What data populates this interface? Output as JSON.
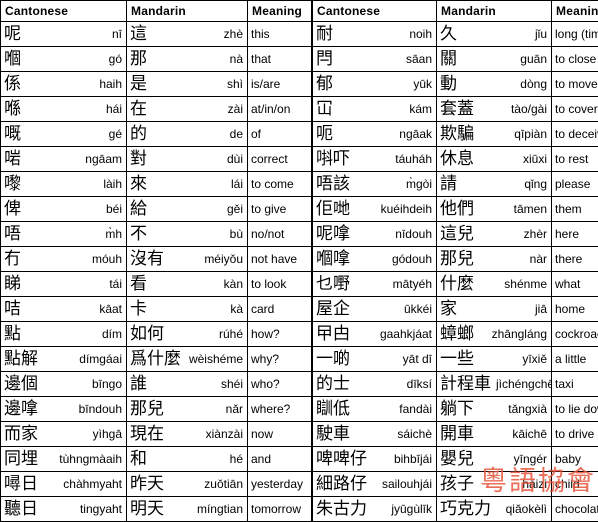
{
  "page": {
    "watermark": "粵語協會"
  },
  "columns": {
    "cantonese": "Cantonese",
    "mandarin": "Mandarin",
    "meaning": "Meaning"
  },
  "tables": [
    {
      "id": "left",
      "rows": [
        {
          "cant_hanzi": "呢",
          "cant_roman": "nī",
          "mand_hanzi": "這",
          "mand_roman": "zhè",
          "meaning": "this"
        },
        {
          "cant_hanzi": "嗰",
          "cant_roman": "gó",
          "mand_hanzi": "那",
          "mand_roman": "nà",
          "meaning": "that"
        },
        {
          "cant_hanzi": "係",
          "cant_roman": "haih",
          "mand_hanzi": "是",
          "mand_roman": "shì",
          "meaning": "is/are"
        },
        {
          "cant_hanzi": "喺",
          "cant_roman": "hái",
          "mand_hanzi": "在",
          "mand_roman": "zài",
          "meaning": "at/in/on"
        },
        {
          "cant_hanzi": "嘅",
          "cant_roman": "gé",
          "mand_hanzi": "的",
          "mand_roman": "de",
          "meaning": "of"
        },
        {
          "cant_hanzi": "啱",
          "cant_roman": "ngāam",
          "mand_hanzi": "對",
          "mand_roman": "dùi",
          "meaning": "correct"
        },
        {
          "cant_hanzi": "嚟",
          "cant_roman": "làih",
          "mand_hanzi": "來",
          "mand_roman": "lái",
          "meaning": "to come"
        },
        {
          "cant_hanzi": "俾",
          "cant_roman": "béi",
          "mand_hanzi": "給",
          "mand_roman": "gěi",
          "meaning": "to give"
        },
        {
          "cant_hanzi": "唔",
          "cant_roman": "m̀h",
          "mand_hanzi": "不",
          "mand_roman": "bù",
          "meaning": "no/not"
        },
        {
          "cant_hanzi": "冇",
          "cant_roman": "móuh",
          "mand_hanzi": "沒有",
          "mand_roman": "méiyǒu",
          "meaning": "not have"
        },
        {
          "cant_hanzi": "睇",
          "cant_roman": "tái",
          "mand_hanzi": "看",
          "mand_roman": "kàn",
          "meaning": "to look"
        },
        {
          "cant_hanzi": "咭",
          "cant_roman": "kāat",
          "mand_hanzi": "卡",
          "mand_roman": "kà",
          "meaning": "card"
        },
        {
          "cant_hanzi": "點",
          "cant_roman": "dím",
          "mand_hanzi": "如何",
          "mand_roman": "rúhé",
          "meaning": "how?"
        },
        {
          "cant_hanzi": "點解",
          "cant_roman": "dímgáai",
          "mand_hanzi": "爲什麼",
          "mand_roman": "wèishéme",
          "meaning": "why?"
        },
        {
          "cant_hanzi": "邊個",
          "cant_roman": "bīngo",
          "mand_hanzi": "誰",
          "mand_roman": "shéi",
          "meaning": "who?"
        },
        {
          "cant_hanzi": "邊嗱",
          "cant_roman": "bīndouh",
          "mand_hanzi": "那兒",
          "mand_roman": "nǎr",
          "meaning": "where?"
        },
        {
          "cant_hanzi": "而家",
          "cant_roman": "yìhgā",
          "mand_hanzi": "現在",
          "mand_roman": "xiànzài",
          "meaning": "now"
        },
        {
          "cant_hanzi": "同埋",
          "cant_roman": "tùhngmàaih",
          "mand_hanzi": "和",
          "mand_roman": "hé",
          "meaning": "and"
        },
        {
          "cant_hanzi": "噚日",
          "cant_roman": "chàhmyaht",
          "mand_hanzi": "昨天",
          "mand_roman": "zuǒtiān",
          "meaning": "yesterday"
        },
        {
          "cant_hanzi": "聽日",
          "cant_roman": "tingyaht",
          "mand_hanzi": "明天",
          "mand_roman": "míngtian",
          "meaning": "tomorrow"
        }
      ]
    },
    {
      "id": "right",
      "rows": [
        {
          "cant_hanzi": "耐",
          "cant_roman": "noih",
          "mand_hanzi": "久",
          "mand_roman": "jǐu",
          "meaning": "long (time)"
        },
        {
          "cant_hanzi": "閂",
          "cant_roman": "sāan",
          "mand_hanzi": "關",
          "mand_roman": "guān",
          "meaning": "to close"
        },
        {
          "cant_hanzi": "郁",
          "cant_roman": "yūk",
          "mand_hanzi": "動",
          "mand_roman": "dòng",
          "meaning": "to move"
        },
        {
          "cant_hanzi": "冚",
          "cant_roman": "kám",
          "mand_hanzi": "套蓋",
          "mand_roman": "tào/gài",
          "meaning": "to cover"
        },
        {
          "cant_hanzi": "呃",
          "cant_roman": "ngāak",
          "mand_hanzi": "欺騙",
          "mand_roman": "qīpiàn",
          "meaning": "to deceive"
        },
        {
          "cant_hanzi": "唞吓",
          "cant_roman": "táuháh",
          "mand_hanzi": "休息",
          "mand_roman": "xiūxi",
          "meaning": "to rest"
        },
        {
          "cant_hanzi": "唔該",
          "cant_roman": "m̀gòi",
          "mand_hanzi": "請",
          "mand_roman": "qǐng",
          "meaning": "please"
        },
        {
          "cant_hanzi": "佢哋",
          "cant_roman": "kuéihdeih",
          "mand_hanzi": "他們",
          "mand_roman": "tāmen",
          "meaning": "them"
        },
        {
          "cant_hanzi": "呢嗱",
          "cant_roman": "nīdouh",
          "mand_hanzi": "這兒",
          "mand_roman": "zhèr",
          "meaning": "here"
        },
        {
          "cant_hanzi": "嗰嗱",
          "cant_roman": "gódouh",
          "mand_hanzi": "那兒",
          "mand_roman": "nàr",
          "meaning": "there"
        },
        {
          "cant_hanzi": "乜嘢",
          "cant_roman": "mātyéh",
          "mand_hanzi": "什麼",
          "mand_roman": "shénme",
          "meaning": "what"
        },
        {
          "cant_hanzi": "屋企",
          "cant_roman": "ūkkéi",
          "mand_hanzi": "家",
          "mand_roman": "jiā",
          "meaning": "home"
        },
        {
          "cant_hanzi": "曱甴",
          "cant_roman": "gaahkjáat",
          "mand_hanzi": "蟑螂",
          "mand_roman": "zhāngláng",
          "meaning": "cockroach"
        },
        {
          "cant_hanzi": "一啲",
          "cant_roman": "yāt dī",
          "mand_hanzi": "一些",
          "mand_roman": "yīxiě",
          "meaning": "a little"
        },
        {
          "cant_hanzi": "的士",
          "cant_roman": "dīksí",
          "mand_hanzi": "計程車",
          "mand_roman": "jìchéngchē",
          "meaning": "taxi"
        },
        {
          "cant_hanzi": "瞓低",
          "cant_roman": "fandài",
          "mand_hanzi": "躺下",
          "mand_roman": "tǎngxià",
          "meaning": "to lie down"
        },
        {
          "cant_hanzi": "駛車",
          "cant_roman": "sáichè",
          "mand_hanzi": "開車",
          "mand_roman": "kāichē",
          "meaning": "to drive"
        },
        {
          "cant_hanzi": "啤啤仔",
          "cant_roman": "bihbījái",
          "mand_hanzi": "嬰兒",
          "mand_roman": "yīngér",
          "meaning": "baby"
        },
        {
          "cant_hanzi": "細路仔",
          "cant_roman": "sailouhjái",
          "mand_hanzi": "孩子",
          "mand_roman": "háizi",
          "meaning": "child"
        },
        {
          "cant_hanzi": "朱古力",
          "cant_roman": "jyūgùlīk",
          "mand_hanzi": "巧克力",
          "mand_roman": "qiǎokèlì",
          "meaning": "chocolate"
        }
      ]
    }
  ]
}
